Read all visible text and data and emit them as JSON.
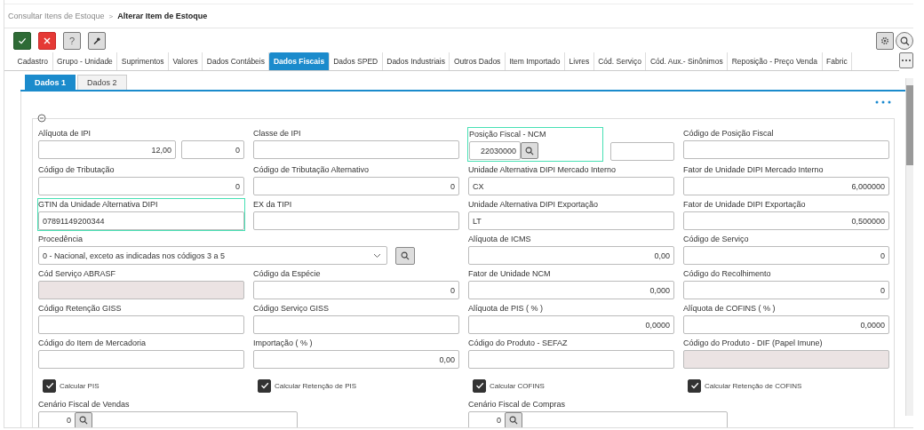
{
  "breadcrumb": {
    "parent": "Consultar Itens de Estoque",
    "separator": ">",
    "current": "Alterar Item de Estoque"
  },
  "toolbar": [
    {
      "kind": "confirm"
    },
    {
      "kind": "cancel"
    },
    {
      "kind": "help",
      "label": "?"
    },
    {
      "kind": "tools"
    }
  ],
  "tabs": [
    {
      "label": "Cadastro",
      "selected": false
    },
    {
      "label": "Grupo - Unidade",
      "selected": false
    },
    {
      "label": "Suprimentos",
      "selected": false
    },
    {
      "label": "Valores",
      "selected": false
    },
    {
      "label": "Dados Contábeis",
      "selected": false
    },
    {
      "label": "Dados Fiscais",
      "selected": true
    },
    {
      "label": "Dados SPED",
      "selected": false
    },
    {
      "label": "Dados Industriais",
      "selected": false
    },
    {
      "label": "Outros Dados",
      "selected": false
    },
    {
      "label": "Item Importado",
      "selected": false
    },
    {
      "label": "Livres",
      "selected": false
    },
    {
      "label": "Cód. Serviço",
      "selected": false
    },
    {
      "label": "Cód. Aux.- Sinônimos",
      "selected": false
    },
    {
      "label": "Reposição - Preço Venda",
      "selected": false
    },
    {
      "label": "Fabric",
      "selected": false
    }
  ],
  "subtabs": [
    {
      "label": "Dados 1",
      "selected": true
    },
    {
      "label": "Dados 2",
      "selected": false
    }
  ],
  "fields": [
    {
      "kind": "pair",
      "label": "Alíquota de IPI",
      "values": [
        "12,00",
        "0"
      ],
      "highlighted": false,
      "disabled": false
    },
    {
      "kind": "text",
      "label": "Classe de IPI",
      "highlighted": false,
      "disabled": false
    },
    {
      "kind": "lookup",
      "label": "Posição Fiscal - NCM",
      "value": "22030000",
      "highlighted": true,
      "disabled": false
    },
    {
      "kind": "text",
      "label": "Código de Posição Fiscal",
      "highlighted": false,
      "disabled": false
    },
    {
      "kind": "number",
      "label": "Código de Tributação",
      "value": "0",
      "highlighted": false,
      "disabled": false
    },
    {
      "kind": "number",
      "label": "Código de Tributação Alternativo",
      "value": "0",
      "highlighted": false,
      "disabled": false
    },
    {
      "kind": "text",
      "label": "Unidade Alternativa DIPI Mercado Interno",
      "value": "CX",
      "highlighted": false,
      "disabled": false
    },
    {
      "kind": "number",
      "label": "Fator de Unidade DIPI Mercado Interno",
      "value": "6,000000",
      "highlighted": false,
      "disabled": false
    },
    {
      "kind": "text",
      "label": "GTIN da Unidade Alternativa DIPI",
      "value": "07891149200344",
      "highlighted": true,
      "disabled": false
    },
    {
      "kind": "text",
      "label": "EX da TIPI",
      "highlighted": false,
      "disabled": false
    },
    {
      "kind": "text",
      "label": "Unidade Alternativa DIPI Exportação",
      "value": "LT",
      "highlighted": false,
      "disabled": false
    },
    {
      "kind": "number",
      "label": "Fator de Unidade DIPI Exportação",
      "value": "0,500000",
      "highlighted": false,
      "disabled": false
    },
    {
      "kind": "select",
      "label": "Procedência",
      "value": "0 - Nacional, exceto as indicadas nos códigos 3 a 5",
      "highlighted": false,
      "disabled": false
    },
    {
      "kind": "number",
      "label": "Alíquota de ICMS",
      "value": "0,00",
      "highlighted": false,
      "disabled": false
    },
    {
      "kind": "number",
      "label": "Código de Serviço",
      "value": "0",
      "highlighted": false,
      "disabled": false
    },
    {
      "kind": "text",
      "label": "Cód Serviço ABRASF",
      "highlighted": false,
      "disabled": true
    },
    {
      "kind": "number",
      "label": "Código da Espécie",
      "value": "0",
      "highlighted": false,
      "disabled": false
    },
    {
      "kind": "number",
      "label": "Fator de Unidade NCM",
      "value": "0,000",
      "highlighted": false,
      "disabled": false
    },
    {
      "kind": "number",
      "label": "Código do Recolhimento",
      "value": "0",
      "highlighted": false,
      "disabled": false
    },
    {
      "kind": "text",
      "label": "Código Retenção GISS",
      "highlighted": false,
      "disabled": false
    },
    {
      "kind": "text",
      "label": "Código Serviço GISS",
      "highlighted": false,
      "disabled": false
    },
    {
      "kind": "number",
      "label": "Alíquota de PIS ( % )",
      "value": "0,0000",
      "highlighted": false,
      "disabled": false
    },
    {
      "kind": "number",
      "label": "Alíquota de COFINS ( % )",
      "value": "0,0000",
      "highlighted": false,
      "disabled": false
    },
    {
      "kind": "text",
      "label": "Código do Item de Mercadoria",
      "highlighted": false,
      "disabled": false
    },
    {
      "kind": "number",
      "label": "Importação ( % )",
      "value": "0,00",
      "highlighted": false,
      "disabled": false
    },
    {
      "kind": "text",
      "label": "Código do Produto - SEFAZ",
      "highlighted": false,
      "disabled": false
    },
    {
      "kind": "text",
      "label": "Código do Produto - DIF (Papel Imune)",
      "highlighted": false,
      "disabled": true
    },
    {
      "kind": "checkbox",
      "label": "Calcular PIS",
      "checked": true
    },
    {
      "kind": "checkbox",
      "label": "Calcular Retenção de PIS",
      "checked": true
    },
    {
      "kind": "checkbox",
      "label": "Calcular COFINS",
      "checked": true
    },
    {
      "kind": "checkbox",
      "label": "Calcular Retenção de COFINS",
      "checked": true
    },
    {
      "kind": "scenario",
      "label": "Cenário Fiscal de Vendas",
      "value": "0"
    },
    {
      "kind": "scenario",
      "label": "Cenário Fiscal de Compras",
      "value": "0"
    }
  ]
}
